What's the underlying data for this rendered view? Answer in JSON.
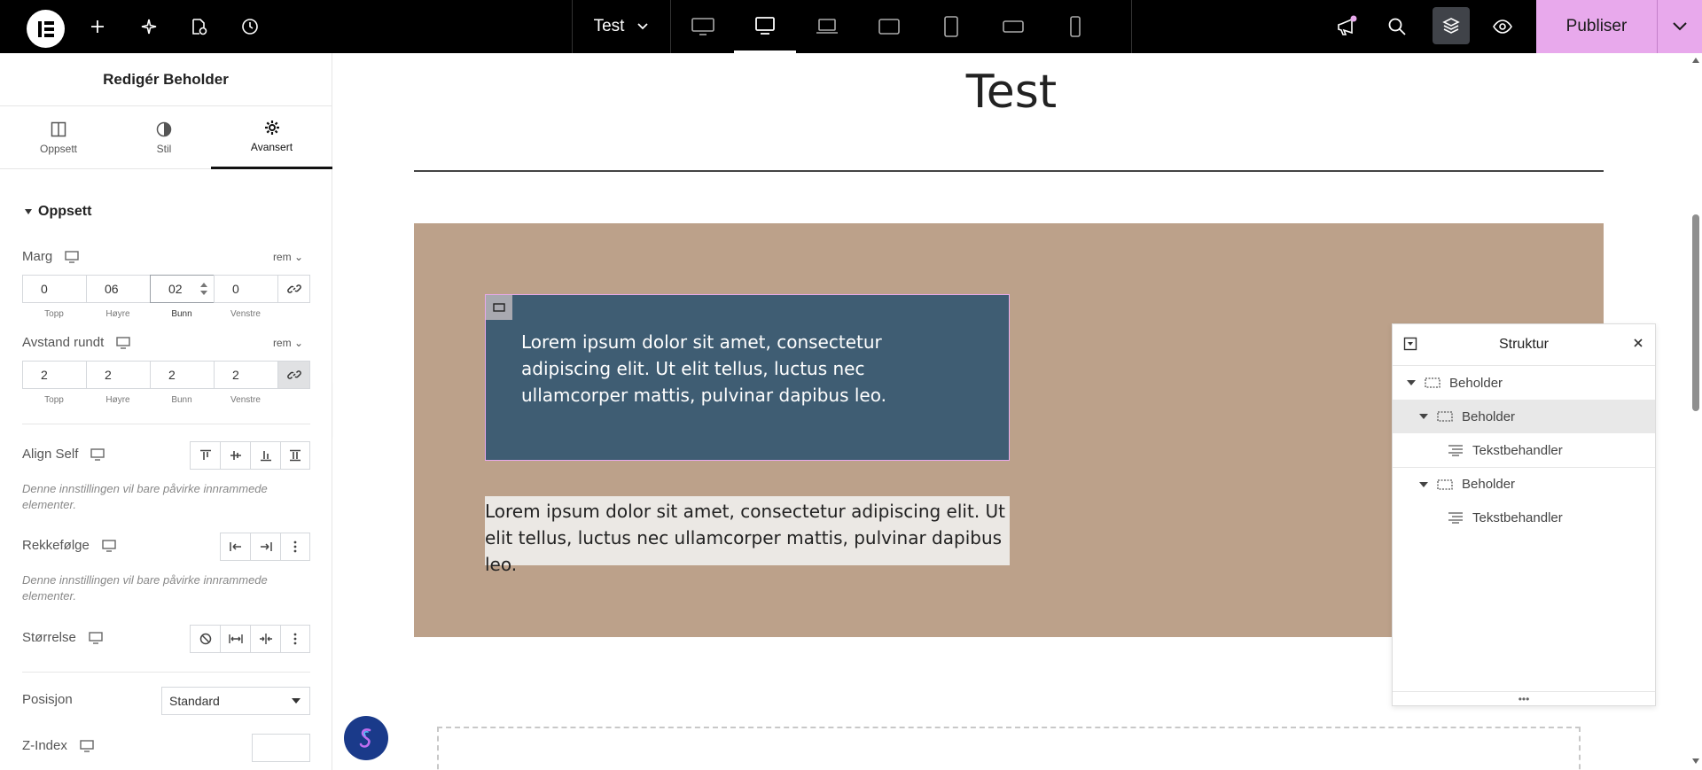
{
  "topbar": {
    "doc_title": "Test",
    "publish_label": "Publiser",
    "publish_color": "#e8a9ec"
  },
  "panel": {
    "title": "Redigér Beholder",
    "tabs": [
      {
        "label": "Oppsett",
        "icon": "layout-icon"
      },
      {
        "label": "Stil",
        "icon": "contrast-icon"
      },
      {
        "label": "Avansert",
        "icon": "gear-icon"
      }
    ],
    "section": "Oppsett",
    "margin": {
      "label": "Marg",
      "unit": "rem",
      "values": [
        "0",
        "06",
        "02",
        "0"
      ],
      "labels": [
        "Topp",
        "Høyre",
        "Bunn",
        "Venstre"
      ]
    },
    "padding": {
      "label": "Avstand rundt",
      "unit": "rem",
      "values": [
        "2",
        "2",
        "2",
        "2"
      ],
      "labels": [
        "Topp",
        "Høyre",
        "Bunn",
        "Venstre"
      ]
    },
    "align_self": {
      "label": "Align Self",
      "hint": "Denne innstillingen vil bare påvirke innrammede elementer."
    },
    "order": {
      "label": "Rekkefølge",
      "hint": "Denne innstillingen vil bare påvirke innrammede elementer."
    },
    "size": {
      "label": "Størrelse"
    },
    "position": {
      "label": "Posisjon",
      "value": "Standard"
    },
    "zindex": {
      "label": "Z-Index",
      "value": ""
    }
  },
  "canvas": {
    "heading": "Test",
    "inner_text": "Lorem ipsum dolor sit amet, consectetur adipiscing elit. Ut elit tellus, luctus nec ullamcorper mattis, pulvinar dapibus leo.",
    "plain_text": "Lorem ipsum dolor sit amet, consectetur adipiscing elit. Ut elit tellus, luctus nec ullamcorper mattis, pulvinar dapibus leo.",
    "outer_color": "#bca18a",
    "inner_color": "#3f5d73"
  },
  "structure": {
    "title": "Struktur",
    "items": [
      {
        "label": "Beholder",
        "level": 0,
        "expanded": true,
        "selected": false
      },
      {
        "label": "Beholder",
        "level": 1,
        "expanded": true,
        "selected": true
      },
      {
        "label": "Tekstbehandler",
        "level": 2,
        "expanded": false,
        "selected": false
      },
      {
        "label": "Beholder",
        "level": 1,
        "expanded": true,
        "selected": false
      },
      {
        "label": "Tekstbehandler",
        "level": 2,
        "expanded": false,
        "selected": false
      }
    ]
  }
}
